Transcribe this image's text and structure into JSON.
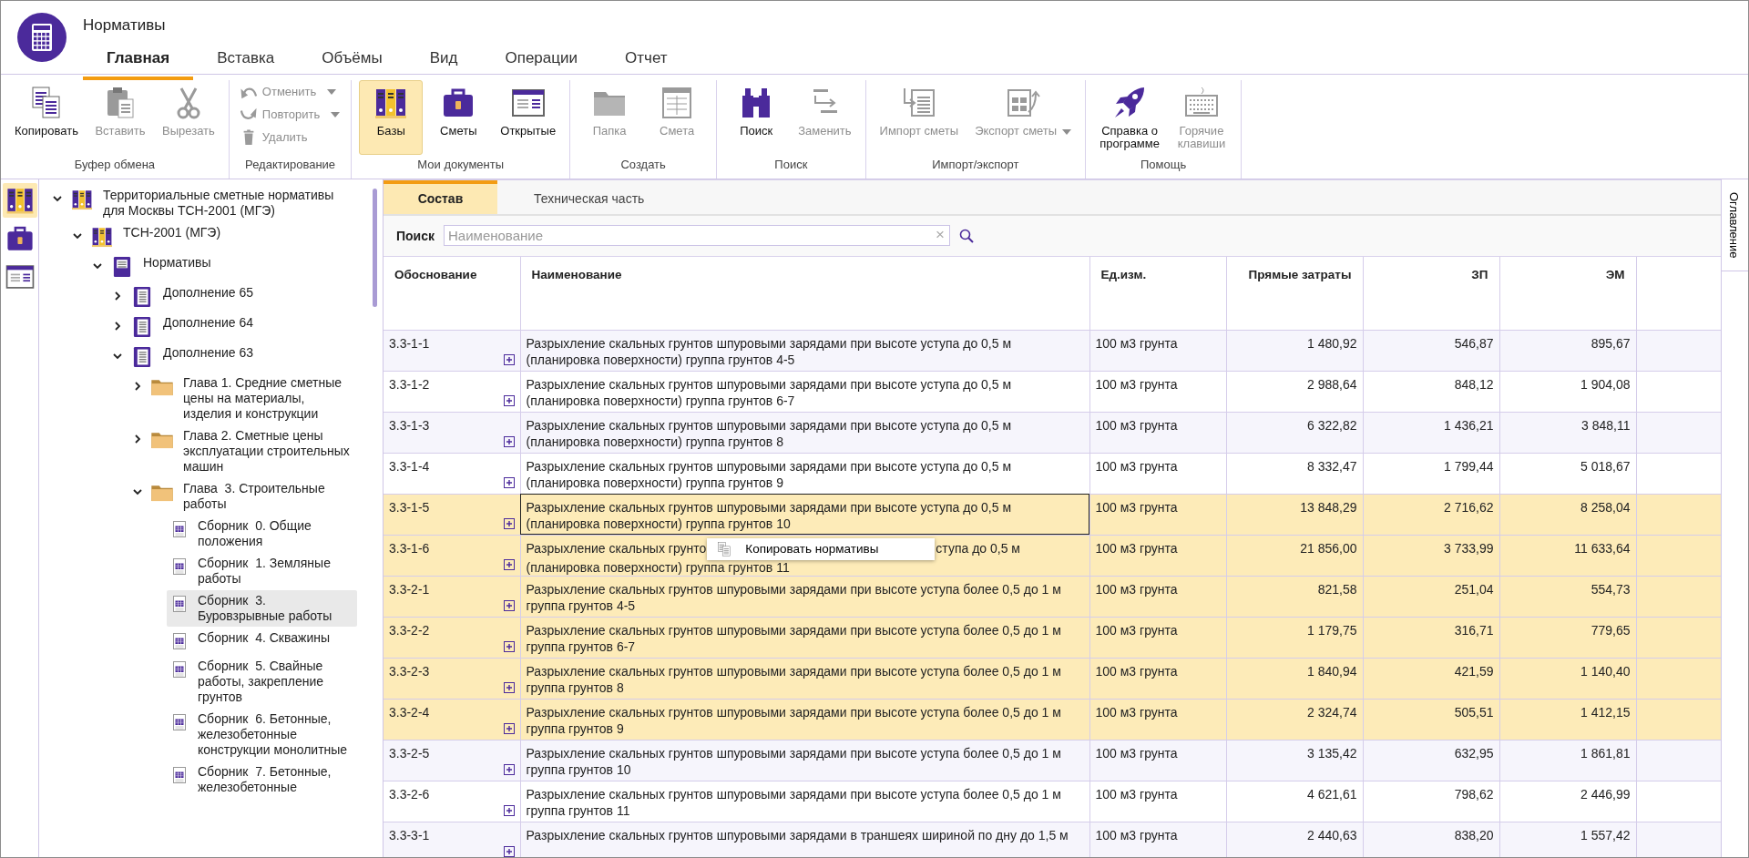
{
  "window": {
    "title": "Нормативы"
  },
  "tabs": [
    {
      "label": "Главная",
      "selected": true
    },
    {
      "label": "Вставка",
      "selected": false
    },
    {
      "label": "Объёмы",
      "selected": false
    },
    {
      "label": "Вид",
      "selected": false
    },
    {
      "label": "Операции",
      "selected": false
    },
    {
      "label": "Отчет",
      "selected": false
    }
  ],
  "ribbon": [
    {
      "label": "Буфер обмена",
      "kind": "row",
      "buttons": [
        {
          "kind": "copy",
          "label": "Копировать",
          "disabled": false,
          "menu": false
        },
        {
          "kind": "paste",
          "label": "Вставить",
          "disabled": true,
          "menu": false
        },
        {
          "kind": "cut",
          "label": "Вырезать",
          "disabled": true,
          "menu": false
        }
      ]
    },
    {
      "label": "Редактирование",
      "kind": "stack",
      "buttons": [
        {
          "kind": "undo",
          "label": "Отменить",
          "disabled": true,
          "menu": true
        },
        {
          "kind": "redo",
          "label": "Повторить",
          "disabled": true,
          "menu": true
        },
        {
          "kind": "delete",
          "label": "Удалить",
          "disabled": true,
          "menu": false
        }
      ]
    },
    {
      "label": "Мои документы",
      "kind": "row",
      "buttons": [
        {
          "kind": "bases",
          "label": "Базы",
          "disabled": false,
          "menu": false,
          "selected": true
        },
        {
          "kind": "estimates",
          "label": "Сметы",
          "disabled": false,
          "menu": false,
          "selected": false
        },
        {
          "kind": "open",
          "label": "Открытые",
          "disabled": false,
          "menu": false,
          "selected": false
        }
      ]
    },
    {
      "label": "Создать",
      "kind": "row",
      "buttons": [
        {
          "kind": "folder",
          "label": "Папка",
          "disabled": true,
          "menu": false
        },
        {
          "kind": "sheet",
          "label": "Смета",
          "disabled": true,
          "menu": false
        }
      ]
    },
    {
      "label": "Поиск",
      "kind": "row",
      "buttons": [
        {
          "kind": "search",
          "label": "Поиск",
          "disabled": false,
          "menu": false
        },
        {
          "kind": "replace",
          "label": "Заменить",
          "disabled": true,
          "menu": false
        }
      ]
    },
    {
      "label": "Импорт/экспорт",
      "kind": "row",
      "buttons": [
        {
          "kind": "import",
          "label": "Импорт сметы",
          "disabled": true,
          "menu": false
        },
        {
          "kind": "export",
          "label": "Экспорт сметы",
          "disabled": true,
          "menu": true
        }
      ]
    },
    {
      "label": "Помощь",
      "kind": "row",
      "buttons": [
        {
          "kind": "help",
          "label": "Справка о\nпрограмме",
          "disabled": false,
          "menu": false
        },
        {
          "kind": "hotkeys",
          "label": "Горячие\nклавиши",
          "disabled": true,
          "menu": false
        }
      ]
    }
  ],
  "sidebar_strip": [
    {
      "kind": "bases",
      "selected": true
    },
    {
      "kind": "estimates",
      "selected": false
    },
    {
      "kind": "open",
      "selected": false
    }
  ],
  "tree": [
    {
      "label": "Территориальные сметные нормативы для Москвы ТСН-2001 (МГЭ)",
      "kind": "base",
      "expanded": true,
      "selected": false,
      "children": [
        {
          "label": "ТСН-2001 (МГЭ)",
          "kind": "base",
          "expanded": true,
          "selected": false,
          "children": [
            {
              "label": "Нормативы",
              "kind": "norms",
              "expanded": true,
              "selected": false,
              "children": [
                {
                  "label": "Дополнение 65",
                  "kind": "book",
                  "expanded": false,
                  "selected": false
                },
                {
                  "label": "Дополнение 64",
                  "kind": "book",
                  "expanded": false,
                  "selected": false
                },
                {
                  "label": "Дополнение 63",
                  "kind": "book",
                  "expanded": true,
                  "selected": false,
                  "children": [
                    {
                      "label": "Глава 1. Средние сметные цены на материалы, изделия и конструкции",
                      "kind": "folder",
                      "expanded": false,
                      "selected": false
                    },
                    {
                      "label": "Глава 2. Сметные цены эксплуатации строительных машин",
                      "kind": "folder",
                      "expanded": false,
                      "selected": false
                    },
                    {
                      "label": "Глава  3. Строительные работы",
                      "kind": "folder",
                      "expanded": true,
                      "selected": false,
                      "children": [
                        {
                          "label": "Сборник  0. Общие положения",
                          "kind": "table",
                          "selected": false
                        },
                        {
                          "label": "Сборник  1. Земляные работы",
                          "kind": "table",
                          "selected": false
                        },
                        {
                          "label": "Сборник  3. Буровзрывные работы",
                          "kind": "table",
                          "selected": true
                        },
                        {
                          "label": "Сборник  4. Скважины",
                          "kind": "table",
                          "selected": false
                        },
                        {
                          "label": "Сборник  5. Свайные работы, закрепление грунтов",
                          "kind": "table",
                          "selected": false
                        },
                        {
                          "label": "Сборник  6. Бетонные, железобетонные конструкции монолитные",
                          "kind": "table",
                          "selected": false
                        },
                        {
                          "label": "Сборник  7. Бетонные, железобетонные",
                          "kind": "table",
                          "selected": false
                        }
                      ]
                    }
                  ]
                }
              ]
            }
          ]
        }
      ]
    }
  ],
  "content_tabs": [
    {
      "label": "Состав",
      "selected": true
    },
    {
      "label": "Техническая часть",
      "selected": false
    }
  ],
  "search": {
    "label": "Поиск",
    "placeholder": "Наименование",
    "clear": "×"
  },
  "table": {
    "columns": [
      {
        "label": "Обоснование",
        "kind": "text"
      },
      {
        "label": "Наименование",
        "kind": "text"
      },
      {
        "label": "Ед.изм.",
        "kind": "text"
      },
      {
        "label": "Прямые затраты",
        "kind": "number"
      },
      {
        "label": "ЗП",
        "kind": "number"
      },
      {
        "label": "ЭМ",
        "kind": "number"
      }
    ],
    "rows": [
      {
        "code": "3.3-1-1",
        "name": "Разрыхление скальных грунтов шпуровыми зарядами при высоте уступа до 0,5 м (планировка поверхности) группа грунтов 4-5",
        "unit": "100 м3 грунта",
        "direct": "1 480,92",
        "zp": "546,87",
        "em": "895,67",
        "selected": false,
        "focused": false
      },
      {
        "code": "3.3-1-2",
        "name": "Разрыхление скальных грунтов шпуровыми зарядами при высоте уступа до 0,5 м (планировка поверхности) группа грунтов 6-7",
        "unit": "100 м3 грунта",
        "direct": "2 988,64",
        "zp": "848,12",
        "em": "1 904,08",
        "selected": false,
        "focused": false
      },
      {
        "code": "3.3-1-3",
        "name": "Разрыхление скальных грунтов шпуровыми зарядами при высоте уступа до 0,5 м (планировка поверхности) группа грунтов 8",
        "unit": "100 м3 грунта",
        "direct": "6 322,82",
        "zp": "1 436,21",
        "em": "3 848,11",
        "selected": false,
        "focused": false
      },
      {
        "code": "3.3-1-4",
        "name": "Разрыхление скальных грунтов шпуровыми зарядами при высоте уступа до 0,5 м (планировка поверхности) группа грунтов 9",
        "unit": "100 м3 грунта",
        "direct": "8 332,47",
        "zp": "1 799,44",
        "em": "5 018,67",
        "selected": false,
        "focused": false
      },
      {
        "code": "3.3-1-5",
        "name": "Разрыхление скальных грунтов шпуровыми зарядами при высоте уступа до 0,5 м (планировка поверхности) группа грунтов 10",
        "unit": "100 м3 грунта",
        "direct": "13 848,29",
        "zp": "2 716,62",
        "em": "8 258,04",
        "selected": true,
        "focused": true
      },
      {
        "code": "3.3-1-6",
        "name_parts": [
          "Разрыхление скальных грунто",
          "ступа до 0,5 м",
          "(планировка поверхности) группа грунтов 11"
        ],
        "unit": "100 м3 грунта",
        "direct": "21 856,00",
        "zp": "3 733,99",
        "em": "11 633,64",
        "selected": true,
        "focused": false
      },
      {
        "code": "3.3-2-1",
        "name": "Разрыхление скальных грунтов шпуровыми зарядами при высоте уступа более 0,5 до 1 м группа грунтов 4-5",
        "unit": "100 м3 грунта",
        "direct": "821,58",
        "zp": "251,04",
        "em": "554,73",
        "selected": true,
        "focused": false
      },
      {
        "code": "3.3-2-2",
        "name": "Разрыхление скальных грунтов шпуровыми зарядами при высоте уступа более 0,5 до 1 м группа грунтов 6-7",
        "unit": "100 м3 грунта",
        "direct": "1 179,75",
        "zp": "316,71",
        "em": "779,65",
        "selected": true,
        "focused": false
      },
      {
        "code": "3.3-2-3",
        "name": "Разрыхление скальных грунтов шпуровыми зарядами при высоте уступа более 0,5 до 1 м группа грунтов 8",
        "unit": "100 м3 грунта",
        "direct": "1 840,94",
        "zp": "421,59",
        "em": "1 140,40",
        "selected": true,
        "focused": false
      },
      {
        "code": "3.3-2-4",
        "name": "Разрыхление скальных грунтов шпуровыми зарядами при высоте уступа более 0,5 до 1 м группа грунтов 9",
        "unit": "100 м3 грунта",
        "direct": "2 324,74",
        "zp": "505,51",
        "em": "1 412,15",
        "selected": true,
        "focused": false
      },
      {
        "code": "3.3-2-5",
        "name": "Разрыхление скальных грунтов шпуровыми зарядами при высоте уступа более 0,5 до 1 м группа грунтов 10",
        "unit": "100 м3 грунта",
        "direct": "3 135,42",
        "zp": "632,95",
        "em": "1 861,81",
        "selected": false,
        "focused": false
      },
      {
        "code": "3.3-2-6",
        "name": "Разрыхление скальных грунтов шпуровыми зарядами при высоте уступа более 0,5 до 1 м группа грунтов 11",
        "unit": "100 м3 грунта",
        "direct": "4 621,61",
        "zp": "798,62",
        "em": "2 446,99",
        "selected": false,
        "focused": false
      },
      {
        "code": "3.3-3-1",
        "name": "Разрыхление скальных грунтов шпуровыми зарядами в траншеях шириной по дну до 1,5 м",
        "unit": "100 м3 грунта",
        "direct": "2 440,63",
        "zp": "838,20",
        "em": "1 557,42",
        "selected": false,
        "focused": false
      }
    ]
  },
  "context_menu": {
    "items": [
      {
        "label": "Копировать нормативы"
      }
    ]
  },
  "side_tab": {
    "label": "Оглавление"
  }
}
